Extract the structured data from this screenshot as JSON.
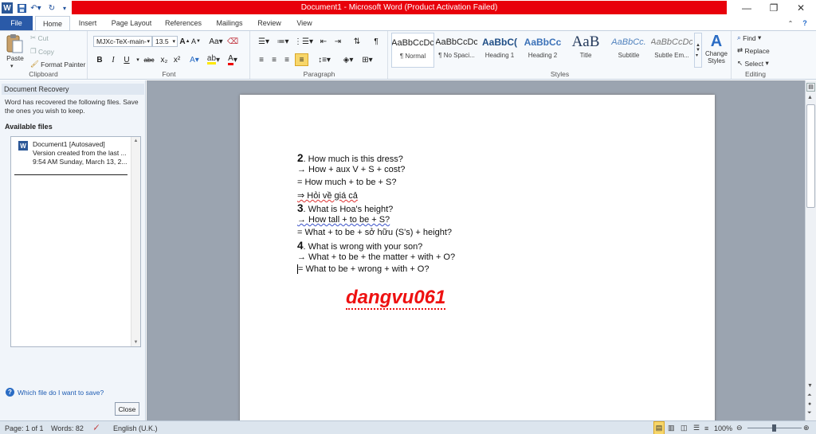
{
  "app": {
    "title": "Document1 - Microsoft Word (Product Activation Failed)",
    "title_bar_color": "#e8000b",
    "logo_letter": "W"
  },
  "window_controls": {
    "minimize": "—",
    "restore": "❐",
    "close": "✕"
  },
  "quick_access": {
    "save_icon": "save-icon",
    "undo_icon": "undo-icon",
    "redo_icon": "redo-icon",
    "customize_icon": "customize-icon"
  },
  "tabs": [
    "File",
    "Home",
    "Insert",
    "Page Layout",
    "References",
    "Mailings",
    "Review",
    "View"
  ],
  "clipboard": {
    "paste_label": "Paste",
    "cut_label": "Cut",
    "copy_label": "Copy",
    "format_painter_label": "Format Painter",
    "group_label": "Clipboard"
  },
  "font": {
    "family": "MJXc-TeX-main-",
    "size": "13.5",
    "group_label": "Font",
    "buttons": [
      "B",
      "I",
      "U",
      "abc",
      "x₂",
      "x²"
    ]
  },
  "paragraph": {
    "group_label": "Paragraph",
    "pilcrow": "¶"
  },
  "styles": {
    "group_label": "Styles",
    "items": [
      {
        "preview": "AaBbCcDc",
        "name": "¶ Normal"
      },
      {
        "preview": "AaBbCcDc",
        "name": "¶ No Spaci..."
      },
      {
        "preview": "AaBbC(",
        "name": "Heading 1"
      },
      {
        "preview": "AaBbCc",
        "name": "Heading 2"
      },
      {
        "preview": "AaB",
        "name": "Title"
      },
      {
        "preview": "AaBbCc.",
        "name": "Subtitle"
      },
      {
        "preview": "AaBbCcDc",
        "name": "Subtle Em..."
      }
    ],
    "change_styles_label": "Change Styles"
  },
  "editing": {
    "group_label": "Editing",
    "find_label": "Find",
    "replace_label": "Replace",
    "select_label": "Select"
  },
  "recovery_pane": {
    "title": "Document Recovery",
    "message": "Word has recovered the following files.  Save the ones you wish to keep.",
    "available_files_label": "Available files",
    "file": {
      "name": "Document1  [Autosaved]",
      "line2": "Version created from the last ...",
      "line3": "9:54 AM Sunday, March 13, 2..."
    },
    "help_link": "Which file do I want to save?",
    "close_label": "Close"
  },
  "document": {
    "lines": [
      {
        "num": "2",
        "text": ". How much is this dress?"
      },
      {
        "num": "",
        "text": "→ How + aux V + S + cost?"
      },
      {
        "num": "",
        "text": "= How much + to be + S?"
      },
      {
        "num": "",
        "text": "⇒ Hỏi về giá cả"
      },
      {
        "num": "3",
        "text": ". What is Hoa's height?"
      },
      {
        "num": "",
        "text": "→ How tall + to be + S?"
      },
      {
        "num": "",
        "text": "= What + to be + sở hữu (S's) + height?"
      },
      {
        "num": "4",
        "text": ". What is wrong with your son?"
      },
      {
        "num": "",
        "text": "→ What + to be + the matter + with + O?"
      },
      {
        "num": "",
        "text": "= What to be + wrong + with + O?"
      }
    ],
    "watermark": "dangvu061"
  },
  "status": {
    "page": "Page: 1 of 1",
    "words": "Words: 82",
    "language": "English (U.K.)",
    "zoom": "100%"
  }
}
